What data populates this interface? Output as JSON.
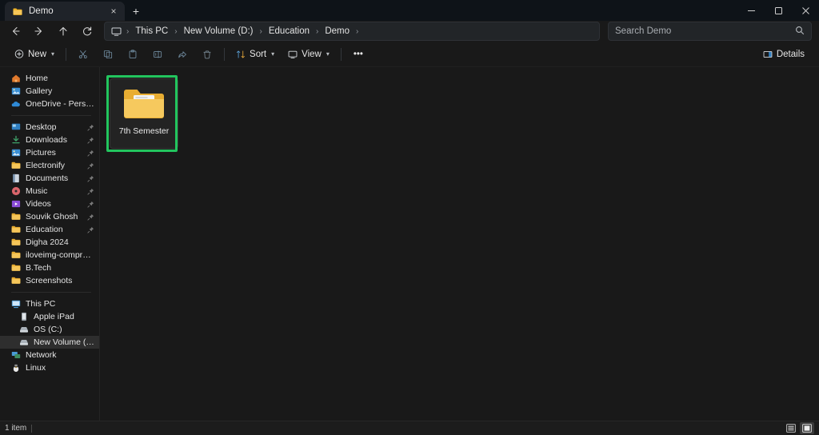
{
  "window": {
    "tab": {
      "title": "Demo",
      "icon": "folder-icon",
      "close_label": "×"
    },
    "new_tab_label": "+",
    "controls": {
      "minimize": "minimize-icon",
      "maximize": "maximize-icon",
      "close": "close-icon"
    }
  },
  "address_bar": {
    "back": "back-arrow-icon",
    "forward": "forward-arrow-icon",
    "up": "up-arrow-icon",
    "refresh": "refresh-icon",
    "breadcrumbs": [
      "This PC",
      "New Volume (D:)",
      "Education",
      "Demo"
    ],
    "separator": "›"
  },
  "search": {
    "placeholder": "Search Demo",
    "value": "",
    "icon": "search-icon"
  },
  "toolbar": {
    "new_label": "New",
    "cut_label": "Cut",
    "copy_label": "Copy",
    "paste_label": "Paste",
    "rename_label": "Rename",
    "share_label": "Share",
    "delete_label": "Delete",
    "sort_label": "Sort",
    "view_label": "View",
    "more_label": "•••",
    "details_label": "Details",
    "chevron": "⌄"
  },
  "sidebar": {
    "groups": [
      {
        "items": [
          {
            "label": "Home",
            "icon": "home-icon",
            "pinned": false,
            "selected": false,
            "indent": false
          },
          {
            "label": "Gallery",
            "icon": "gallery-icon",
            "pinned": false,
            "selected": false,
            "indent": false
          },
          {
            "label": "OneDrive - Personal",
            "icon": "onedrive-icon",
            "pinned": false,
            "selected": false,
            "indent": false
          }
        ]
      },
      {
        "items": [
          {
            "label": "Desktop",
            "icon": "desktop-icon",
            "pinned": true,
            "selected": false,
            "indent": false
          },
          {
            "label": "Downloads",
            "icon": "downloads-icon",
            "pinned": true,
            "selected": false,
            "indent": false
          },
          {
            "label": "Pictures",
            "icon": "pictures-icon",
            "pinned": true,
            "selected": false,
            "indent": false
          },
          {
            "label": "Electronify",
            "icon": "folder-icon",
            "pinned": true,
            "selected": false,
            "indent": false
          },
          {
            "label": "Documents",
            "icon": "documents-icon",
            "pinned": true,
            "selected": false,
            "indent": false
          },
          {
            "label": "Music",
            "icon": "music-icon",
            "pinned": true,
            "selected": false,
            "indent": false
          },
          {
            "label": "Videos",
            "icon": "videos-icon",
            "pinned": true,
            "selected": false,
            "indent": false
          },
          {
            "label": "Souvik Ghosh",
            "icon": "folder-icon",
            "pinned": true,
            "selected": false,
            "indent": false
          },
          {
            "label": "Education",
            "icon": "folder-icon",
            "pinned": true,
            "selected": false,
            "indent": false
          },
          {
            "label": "Digha 2024",
            "icon": "folder-icon",
            "pinned": false,
            "selected": false,
            "indent": false
          },
          {
            "label": "iloveimg-compressed",
            "icon": "folder-icon",
            "pinned": false,
            "selected": false,
            "indent": false
          },
          {
            "label": "B.Tech",
            "icon": "folder-icon",
            "pinned": false,
            "selected": false,
            "indent": false
          },
          {
            "label": "Screenshots",
            "icon": "folder-icon",
            "pinned": false,
            "selected": false,
            "indent": false
          }
        ]
      },
      {
        "items": [
          {
            "label": "This PC",
            "icon": "this-pc-icon",
            "pinned": false,
            "selected": false,
            "indent": false
          },
          {
            "label": "Apple iPad",
            "icon": "ipad-icon",
            "pinned": false,
            "selected": false,
            "indent": true
          },
          {
            "label": "OS (C:)",
            "icon": "drive-icon",
            "pinned": false,
            "selected": false,
            "indent": true
          },
          {
            "label": "New Volume (D:)",
            "icon": "drive-icon",
            "pinned": false,
            "selected": true,
            "indent": true
          },
          {
            "label": "Network",
            "icon": "network-icon",
            "pinned": false,
            "selected": false,
            "indent": false
          },
          {
            "label": "Linux",
            "icon": "linux-icon",
            "pinned": false,
            "selected": false,
            "indent": false
          }
        ]
      }
    ]
  },
  "content": {
    "items": [
      {
        "name": "7th Semester",
        "icon": "folder-icon",
        "selected": true,
        "highlighted": true
      }
    ],
    "highlight_color": "#22c55e"
  },
  "status_bar": {
    "item_count": "1 item",
    "list_view_label": "Details view",
    "icons_view_label": "Large icons view",
    "active_view": "icons"
  }
}
